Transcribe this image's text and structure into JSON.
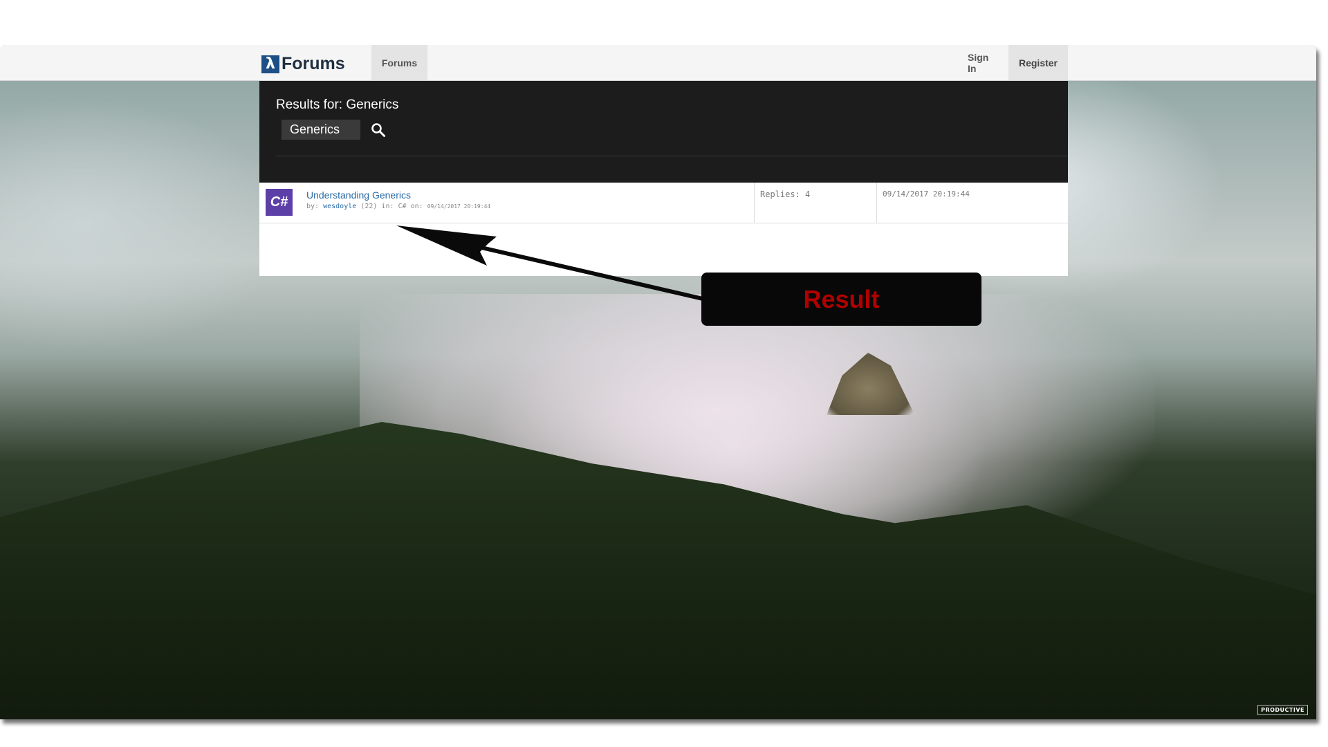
{
  "nav": {
    "logo_glyph": "λ",
    "logo_text": "Forums",
    "forums_link": "Forums",
    "signin_link": "Sign In",
    "register_link": "Register"
  },
  "search": {
    "results_title": "Results for: Generics",
    "query": "Generics",
    "search_icon": "search-icon"
  },
  "results": [
    {
      "forum_badge": "C#",
      "title": "Understanding Generics",
      "by_label": "by:",
      "author": "wesdoyle",
      "author_rating": "(22)",
      "in_label": "in:",
      "forum": "C#",
      "on_label": "on:",
      "posted": "09/14/2017 20:19:44",
      "replies": "Replies: 4",
      "date": "09/14/2017 20:19:44"
    }
  ],
  "annotation": {
    "callout_text": "Result"
  },
  "watermark": "PRODUCTIVE",
  "colors": {
    "brand": "#1d4f86",
    "header_bg": "#1c1c1c",
    "link": "#2a6aa5",
    "forum_badge": "#5d3fa8",
    "callout_text": "#b10000"
  }
}
